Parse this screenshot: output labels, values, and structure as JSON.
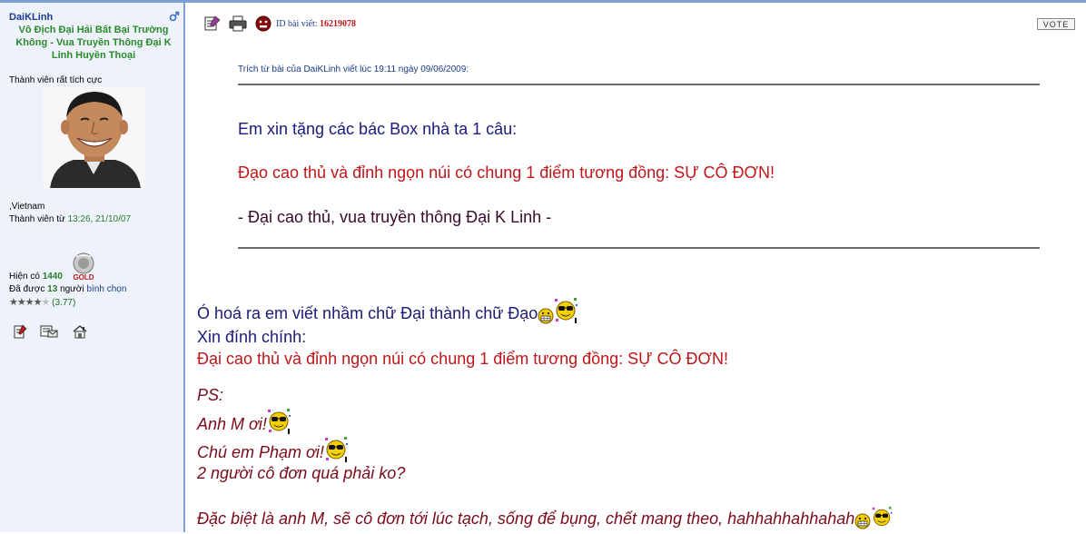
{
  "profile": {
    "username": "DaiKLinh",
    "title": "Vô Địch Đại Hải Bất Bại Trường Không - Vua Truyền Thông Đại K Linh Huyền Thoại",
    "rank": "Thành viên rất tích cực",
    "location": ",Vietnam",
    "joined_label": "Thành viên từ",
    "joined_value": "13:26, 21/10/07",
    "points_label": "Hiện có",
    "points_value": "1440",
    "badge_text": "GOLD",
    "voters_prefix": "Đã được",
    "voters_count": "13",
    "voters_suffix": "người",
    "voters_link": "bình chọn",
    "rating": "(3.77)",
    "stars_filled": 4,
    "stars_total": 5
  },
  "toolbar": {
    "post_id_label": "ID bài viết:",
    "post_id_value": "16219078",
    "vote_label": "VOTE"
  },
  "quote": {
    "header": "Trích từ bài của DaiKLinh viết lúc 19:11 ngày 09/06/2009:",
    "line1": "Em xin tặng các bác Box nhà ta 1 câu:",
    "line2": "Đạo cao thủ và đỉnh ngọn núi có chung 1 điểm tương đồng: SỰ CÔ ĐƠN!",
    "line3": "- Đại cao thủ, vua truyền thông Đại K Linh -"
  },
  "body": {
    "line1": "Ó hoá ra em viết nhầm chữ Đại thành chữ Đạo",
    "line2": "Xin đính chính:",
    "line3": "Đại cao thủ và đỉnh ngọn núi có chung 1 điểm tương đồng: SỰ CÔ ĐƠN!",
    "ps": "PS:",
    "ps1": "Anh M ơi!",
    "ps2": "Chú em Phạm ơi!",
    "ps3": "2 người cô đơn quá phải ko?",
    "ps4": "Đặc biệt là anh M, sẽ cô đơn tới lúc tạch, sống để bụng, chết mang theo, hahhahhahhahah"
  },
  "colors": {
    "sidebar_bg": "#eef3fb",
    "border": "#7e9fd1",
    "username": "#1a3a8a",
    "title_green": "#2a8a2a",
    "navy_text": "#1a1a7a",
    "red_text": "#c0161a",
    "maroon_text": "#7a0a1a"
  },
  "icons": [
    "gender-male-icon",
    "edit-post-icon",
    "print-icon",
    "report-icon",
    "profile-icon",
    "message-icon",
    "home-icon",
    "grin-smiley-icon",
    "cool-smiley-icon"
  ]
}
